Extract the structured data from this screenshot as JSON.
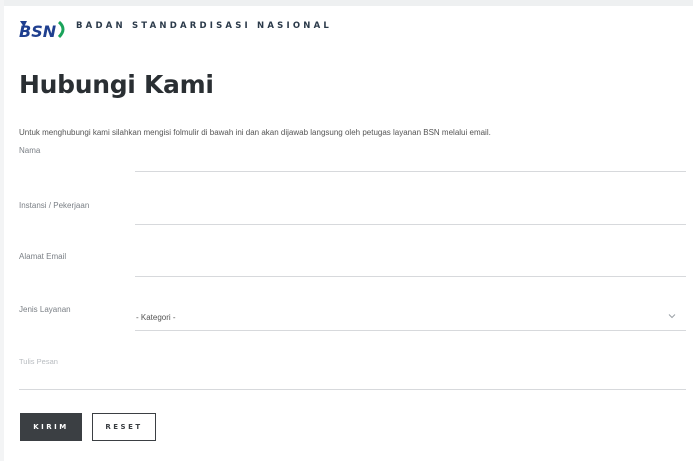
{
  "header": {
    "logo_text": "BSN",
    "brand_text": "BADAN STANDARDISASI NASIONAL"
  },
  "page": {
    "title": "Hubungi Kami",
    "intro": "Untuk menghubungi kami silahkan mengisi folmulir di bawah ini dan akan dijawab langsung oleh petugas layanan BSN melalui email."
  },
  "form": {
    "name_label": "Nama",
    "job_label": "Instansi / Pekerjaan",
    "email_label": "Alamat Email",
    "service_label": "Jenis Layanan",
    "service_value": "- Kategori -",
    "message_placeholder": "Tulis Pesan",
    "submit_label": "KIRIM",
    "reset_label": "RESET"
  },
  "colors": {
    "brand_blue": "#1f3f8f",
    "brand_green": "#1aa35a",
    "button_dark": "#3b3f43"
  }
}
